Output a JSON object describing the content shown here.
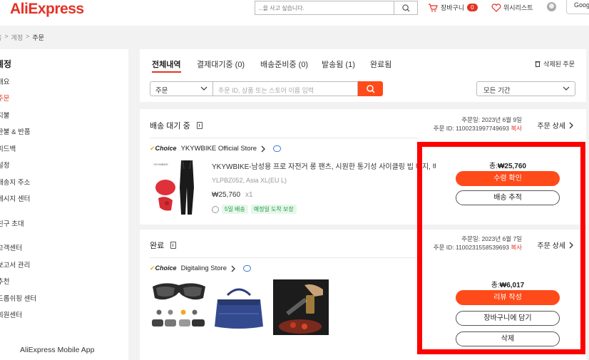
{
  "header": {
    "logo": "AliExpress",
    "search_placeholder": "...을 사고 싶습니다.",
    "cart_label": "장바구니",
    "cart_count": "0",
    "wishlist_label": "위시리스트",
    "google_label": "Goog"
  },
  "breadcrumb": [
    "홈",
    "계정",
    "주문"
  ],
  "sidebar": {
    "title": "계정",
    "items": [
      "개요",
      "주문",
      "지불",
      "환불 & 반품",
      "피드백",
      "설정",
      "배송지 주소",
      "메시지 센터",
      "친구 초대",
      "고객센터",
      "보고서 관리",
      "추천",
      "드롭쉬핑 센터",
      "회원센터"
    ],
    "active_item": "주문",
    "app_label": "AliExpress Mobile App"
  },
  "tabs": {
    "items": [
      "전체내역",
      "결제대기중 (0)",
      "배송준비중 (0)",
      "발송됨 (1)",
      "완료됨"
    ],
    "deleted_link": "삭제된 주문"
  },
  "filters": {
    "order_select": "주문",
    "search_placeholder": "주문 ID, 상품 또는 스토어 이름 입력",
    "period_select": "모든 기간"
  },
  "orders": [
    {
      "status": "배송 대기 중",
      "order_date": "주문일: 2023년 6월 9일",
      "order_id": "주문 ID: 1100231997749693",
      "copy_label": "복사",
      "detail_label": "주문 상세",
      "store": "YKYWBIKE Official Store",
      "choice_label": "Choice",
      "product_title": "YKYWBIKE-남성용 프로 자전거 롱 팬츠, 시원한 통기성 사이클링 빕 바지, 배...",
      "variant": "YLPBZ052, Asia XL(EU L)",
      "price": "₩25,760",
      "qty": "x1",
      "chip_delivery": "5일 배송",
      "chip_guarantee": "예정일 도착 보장",
      "total_label": "총:",
      "total": "₩25,760",
      "primary_action": "수령 확인",
      "secondary_action": "배송 추적"
    },
    {
      "status": "완료",
      "order_date": "주문일: 2023년 6월 7일",
      "order_id": "주문 ID: 1100231558539693",
      "copy_label": "복사",
      "detail_label": "주문 상세",
      "store": "Digitaling Store",
      "choice_label": "Choice",
      "total_label": "총:",
      "total": "₩6,017",
      "primary_action": "리뷰 작성",
      "secondary_action": "장바구니에 담기",
      "tertiary_action": "삭제"
    }
  ],
  "colors": {
    "brand": "#e43225",
    "accent": "#ff4a1a",
    "highlight": "#ff0000"
  }
}
